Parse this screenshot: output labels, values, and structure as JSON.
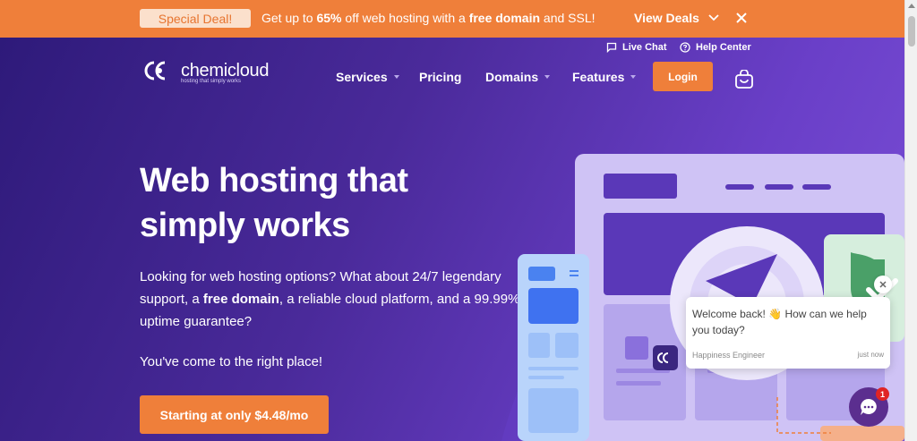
{
  "promo": {
    "badge": "Special Deal!",
    "text_prefix": "Get up to ",
    "text_percent": "65%",
    "text_mid": " off web hosting with a ",
    "text_bold": "free domain",
    "text_suffix": " and SSL!",
    "view_deals": "View Deals"
  },
  "utility": {
    "live_chat": "Live Chat",
    "help_center": "Help Center"
  },
  "logo": {
    "name": "chemicloud",
    "tagline": "hosting that simply works"
  },
  "nav": {
    "services": "Services",
    "pricing": "Pricing",
    "domains": "Domains",
    "features": "Features",
    "login": "Login"
  },
  "hero": {
    "headline_line1": "Web hosting that",
    "headline_line2": "simply works",
    "sub_part1": "Looking for web hosting options? What about 24/7 legendary support, a ",
    "sub_bold": "free domain",
    "sub_part2": ", a reliable cloud platform, and a 99.99% uptime guarantee?",
    "sub2": "You've come to the right place!",
    "cta": "Starting at only $4.48/mo"
  },
  "chat": {
    "message_1": "Welcome back! ",
    "message_emoji": "👋",
    "message_2": " How can we help you today?",
    "sender": "Happiness Engineer",
    "time": "just now",
    "badge_count": "1"
  },
  "colors": {
    "accent": "#ef7f3a",
    "hero_bg": "#4a2a9a",
    "chat_launcher": "#5b2e8f"
  }
}
